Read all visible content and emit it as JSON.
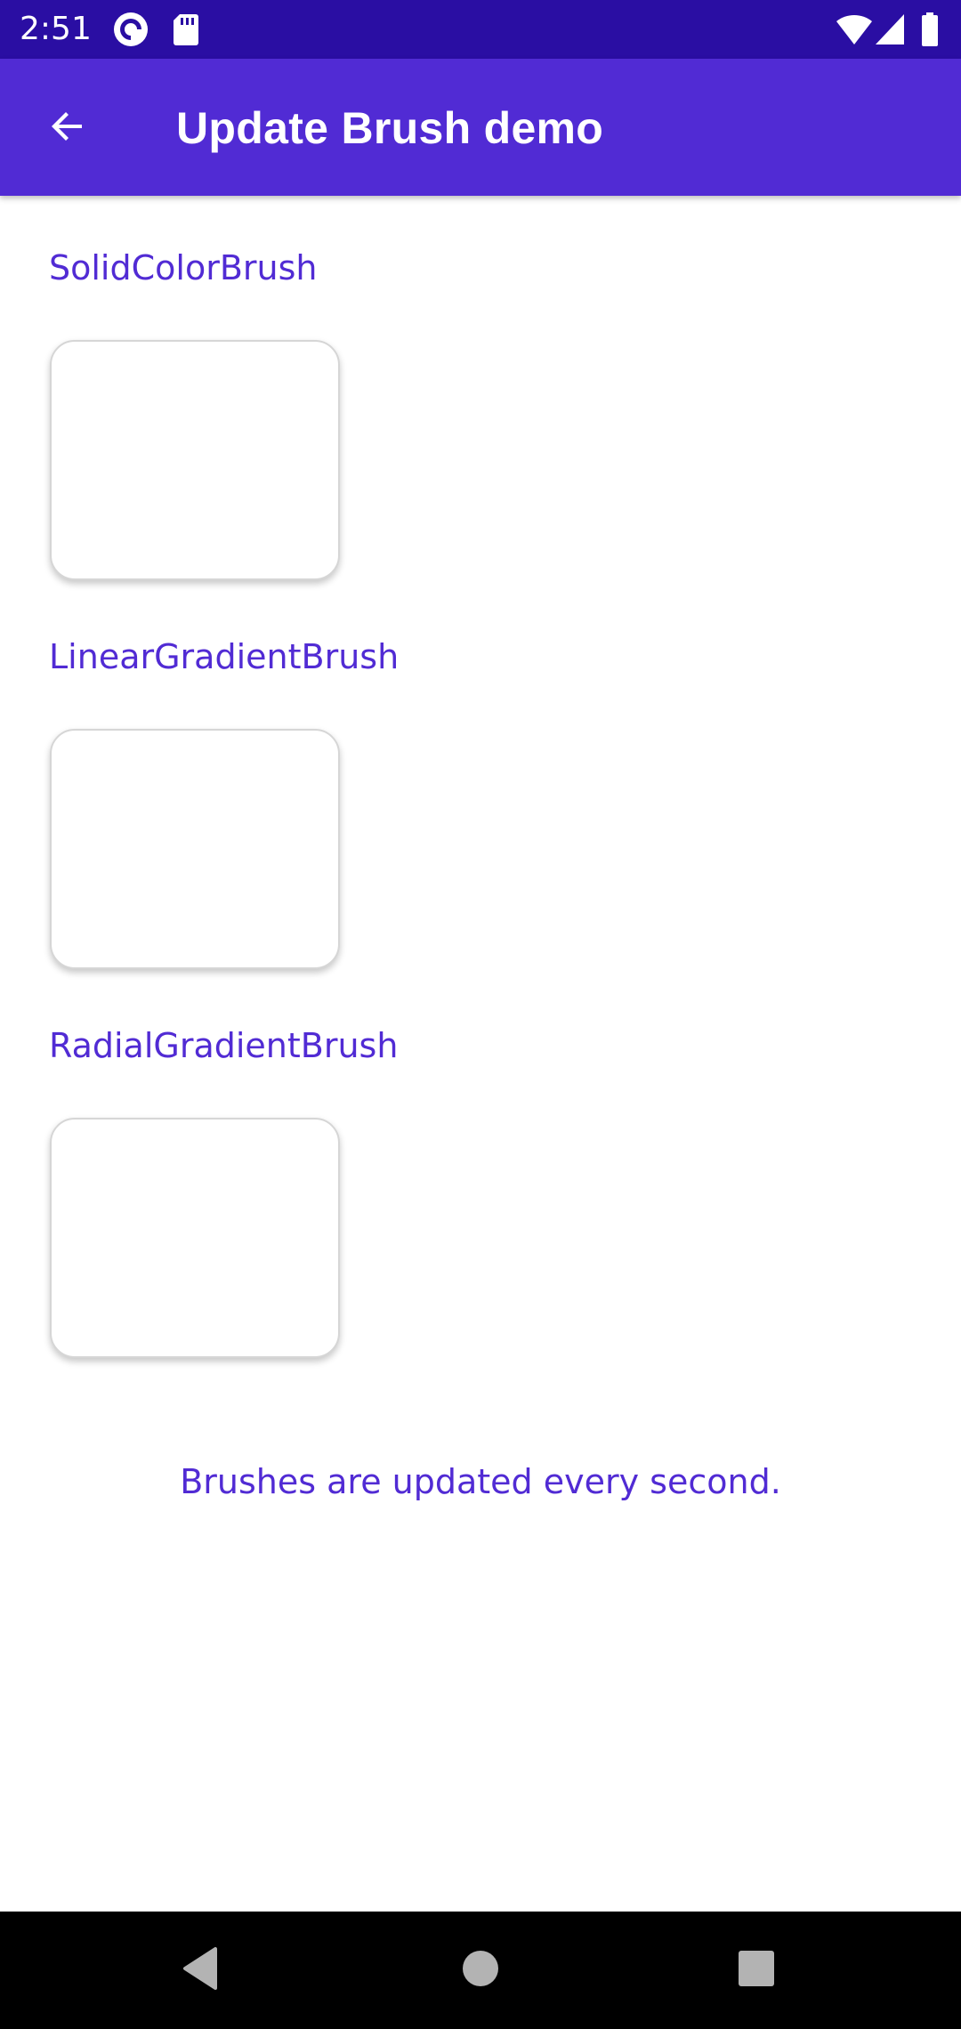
{
  "status_bar": {
    "time": "2:51",
    "left_icons": [
      "pocket-casts-icon",
      "sd-card-icon"
    ],
    "right_icons": [
      "wifi-icon",
      "cell-signal-icon",
      "battery-icon"
    ]
  },
  "app_bar": {
    "title": "Update Brush demo",
    "back_icon": "arrow-back-icon"
  },
  "sections": [
    {
      "label": "SolidColorBrush"
    },
    {
      "label": "LinearGradientBrush"
    },
    {
      "label": "RadialGradientBrush"
    }
  ],
  "footer_note": "Brushes are updated every second.",
  "nav_bar": {
    "icons": [
      "back-triangle-icon",
      "home-circle-icon",
      "recents-square-icon"
    ]
  },
  "colors": {
    "accent": "#512bd4",
    "status_bar": "#2a0ea3",
    "nav_bar": "#000000",
    "nav_icons": "#b3b3b3"
  }
}
